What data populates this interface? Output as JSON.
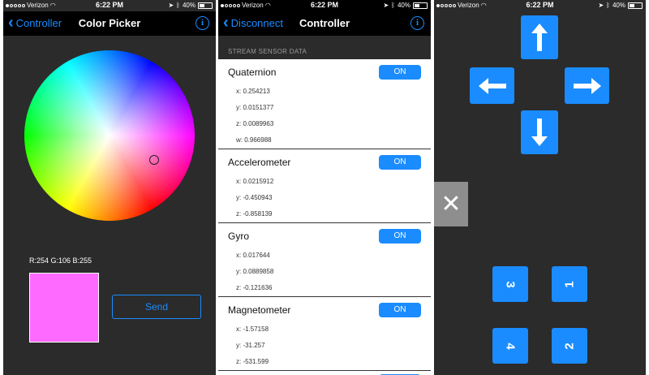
{
  "status": {
    "carrier": "Verizon",
    "time": "6:22 PM",
    "battery": "40%"
  },
  "screen1": {
    "back_label": "Controller",
    "title": "Color Picker",
    "rgb_label": "R:254  G:106  B:255",
    "swatch_color": "#fe6aff",
    "send_label": "Send"
  },
  "screen2": {
    "back_label": "Disconnect",
    "title": "Controller",
    "section_header": "STREAM SENSOR DATA",
    "sensors": [
      {
        "name": "Quaternion",
        "toggle": "ON",
        "values": [
          "x: 0.254213",
          "y: 0.0151377",
          "z: 0.0089963",
          "w: 0.966988"
        ]
      },
      {
        "name": "Accelerometer",
        "toggle": "ON",
        "values": [
          "x: 0.0215912",
          "y: -0.450943",
          "z: -0.858139"
        ]
      },
      {
        "name": "Gyro",
        "toggle": "ON",
        "values": [
          "x: 0.017644",
          "y: 0.0889858",
          "z: -0.121636"
        ]
      },
      {
        "name": "Magnetometer",
        "toggle": "ON",
        "values": [
          "x: -1.57158",
          "y: -31.257",
          "z: -531.599"
        ]
      }
    ]
  },
  "screen3": {
    "buttons": {
      "b1": "1",
      "b2": "2",
      "b3": "3",
      "b4": "4"
    }
  },
  "colors": {
    "accent": "#1a8cff",
    "dark_bg": "#2b2b2b",
    "navbar": "#000000",
    "close_button": "#8e8e8e"
  }
}
